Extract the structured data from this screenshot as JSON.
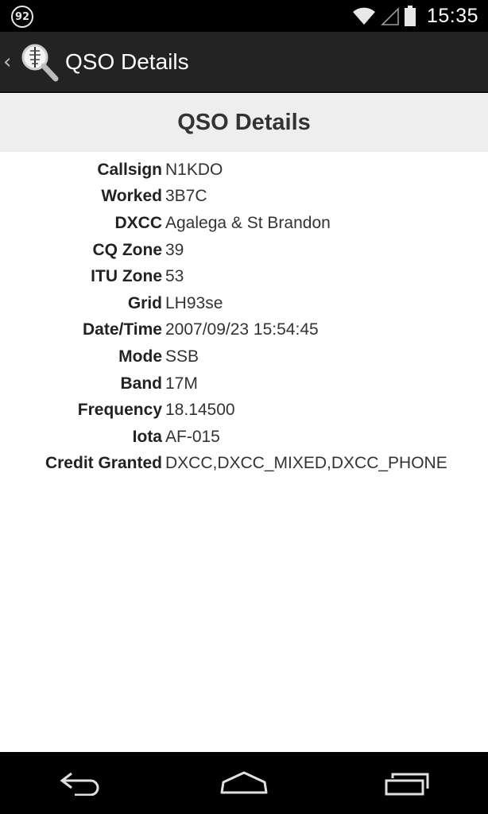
{
  "status_bar": {
    "notification_badge": "92",
    "time": "15:35",
    "icons": [
      "wifi-icon",
      "cell-signal-icon",
      "battery-icon"
    ]
  },
  "action_bar": {
    "title": "QSO Details",
    "icons": [
      "up-chevron-icon",
      "app-logo-magnifier-icon"
    ]
  },
  "section": {
    "title": "QSO Details"
  },
  "details": [
    {
      "label": "Callsign",
      "value": "N1KDO"
    },
    {
      "label": "Worked",
      "value": "3B7C"
    },
    {
      "label": "DXCC",
      "value": "Agalega & St Brandon"
    },
    {
      "label": "CQ Zone",
      "value": "39"
    },
    {
      "label": "ITU Zone",
      "value": "53"
    },
    {
      "label": "Grid",
      "value": "LH93se"
    },
    {
      "label": "Date/Time",
      "value": "2007/09/23 15:54:45"
    },
    {
      "label": "Mode",
      "value": "SSB"
    },
    {
      "label": "Band",
      "value": "17M"
    },
    {
      "label": "Frequency",
      "value": "18.14500"
    },
    {
      "label": "Iota",
      "value": "AF-015"
    },
    {
      "label": "Credit Granted",
      "value": "DXCC,DXCC_MIXED,DXCC_PHONE"
    }
  ],
  "nav_bar": {
    "icons": [
      "back-icon",
      "home-icon",
      "recents-icon"
    ]
  }
}
